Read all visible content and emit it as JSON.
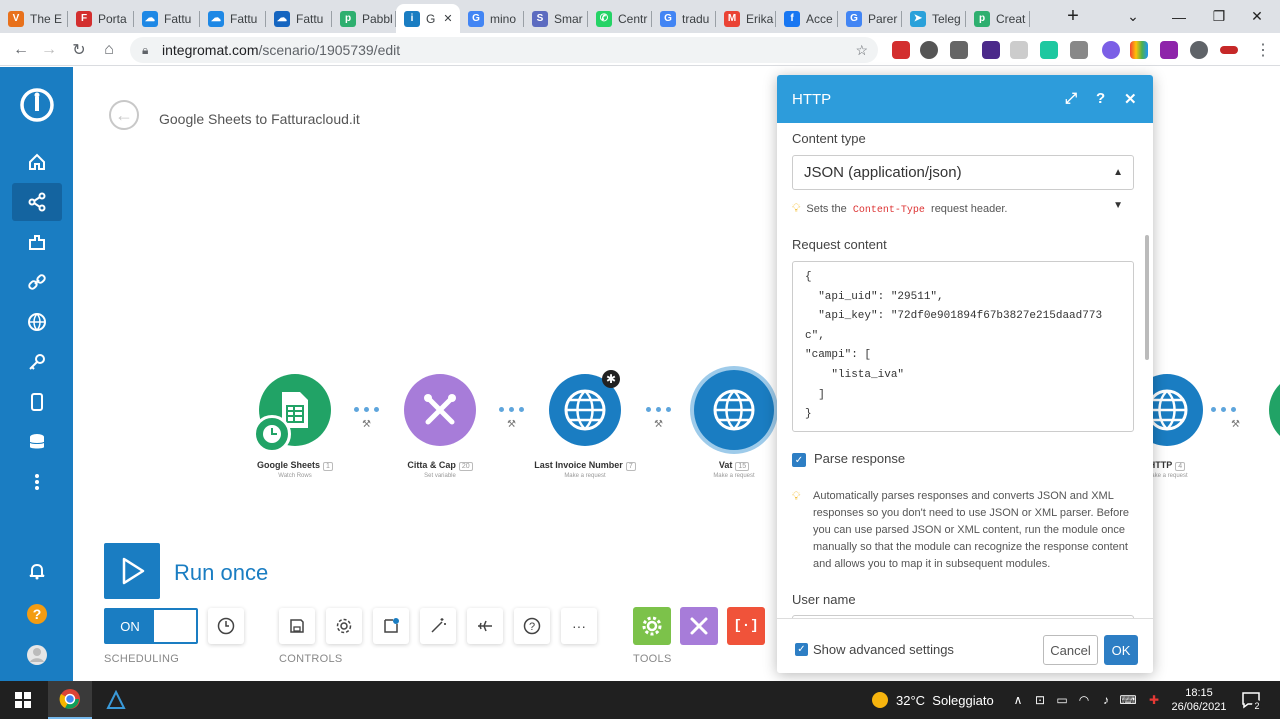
{
  "browser": {
    "tabs": [
      {
        "label": "The E",
        "color": "#e8711c",
        "glyph": "V"
      },
      {
        "label": "Porta",
        "color": "#d32f2f",
        "glyph": "F"
      },
      {
        "label": "Fattu",
        "color": "#1e88e5",
        "glyph": "☁"
      },
      {
        "label": "Fattu",
        "color": "#1e88e5",
        "glyph": "☁"
      },
      {
        "label": "Fattu",
        "color": "#1565c0",
        "glyph": "☁"
      },
      {
        "label": "Pabbl",
        "color": "#2eaf6f",
        "glyph": "p"
      },
      {
        "label": "G",
        "color": "#1a7dc2",
        "glyph": "i"
      },
      {
        "label": "mino",
        "color": "#4285f4",
        "glyph": "G"
      },
      {
        "label": "Smar",
        "color": "#5c6bc0",
        "glyph": "S"
      },
      {
        "label": "Centr",
        "color": "#25d366",
        "glyph": "✆"
      },
      {
        "label": "tradu",
        "color": "#4285f4",
        "glyph": "G"
      },
      {
        "label": "Erika",
        "color": "#ea4335",
        "glyph": "M"
      },
      {
        "label": "Acce",
        "color": "#1877f2",
        "glyph": "f"
      },
      {
        "label": "Parer",
        "color": "#4285f4",
        "glyph": "G"
      },
      {
        "label": "Teleg",
        "color": "#2aa1da",
        "glyph": "➤"
      },
      {
        "label": "Creat",
        "color": "#2eaf6f",
        "glyph": "p"
      }
    ],
    "url_host": "integromat.com",
    "url_path": "/scenario/1905739/edit"
  },
  "scenario": {
    "title": "Google Sheets to Fatturacloud.it",
    "modules": [
      {
        "name": "Google Sheets",
        "id": "1",
        "sub": "Watch Rows",
        "color": "#21a366"
      },
      {
        "name": "Citta & Cap",
        "id": "20",
        "sub": "Set variable",
        "color": "#a77cd9"
      },
      {
        "name": "Last Invoice Number",
        "id": "7",
        "sub": "Make a request",
        "color": "#1a7dc2"
      },
      {
        "name": "Vat",
        "id": "15",
        "sub": "Make a request",
        "color": "#1a7dc2"
      },
      {
        "name": "HTTP",
        "id": "4",
        "sub": "Make a request",
        "color": "#1a7dc2"
      }
    ],
    "run_once_label": "Run once",
    "toggle_label": "ON",
    "scheduling_label": "SCHEDULING",
    "controls_label": "CONTROLS",
    "tools_label": "TOOLS"
  },
  "panel": {
    "title": "HTTP",
    "content_type_label": "Content type",
    "content_type_value": "JSON (application/json)",
    "hint_prefix": "Sets the",
    "hint_code": "Content-Type",
    "hint_suffix": "request header.",
    "request_content_label": "Request content",
    "request_content": "{\n  \"api_uid\": \"29511\",\n  \"api_key\": \"72df0e901894f67b3827e215daad773\nc\",\n\"campi\": [\n    \"lista_iva\"\n  ]\n}",
    "parse_response_label": "Parse response",
    "parse_hint": "Automatically parses responses and converts JSON and XML responses so you don't need to use JSON or XML parser. Before you can use parsed JSON or XML content, run the module once manually so that the module can recognize the response content and allows you to map it in subsequent modules.",
    "user_name_label": "User name",
    "show_advanced_label": "Show advanced settings",
    "cancel_label": "Cancel",
    "ok_label": "OK"
  },
  "taskbar": {
    "weather": "32°C  Soleggiato",
    "time": "18:15",
    "date": "26/06/2021",
    "notifications": "2"
  },
  "colors": {
    "integromat_blue": "#1a7dc2",
    "panel_header": "#2d9cdb"
  }
}
